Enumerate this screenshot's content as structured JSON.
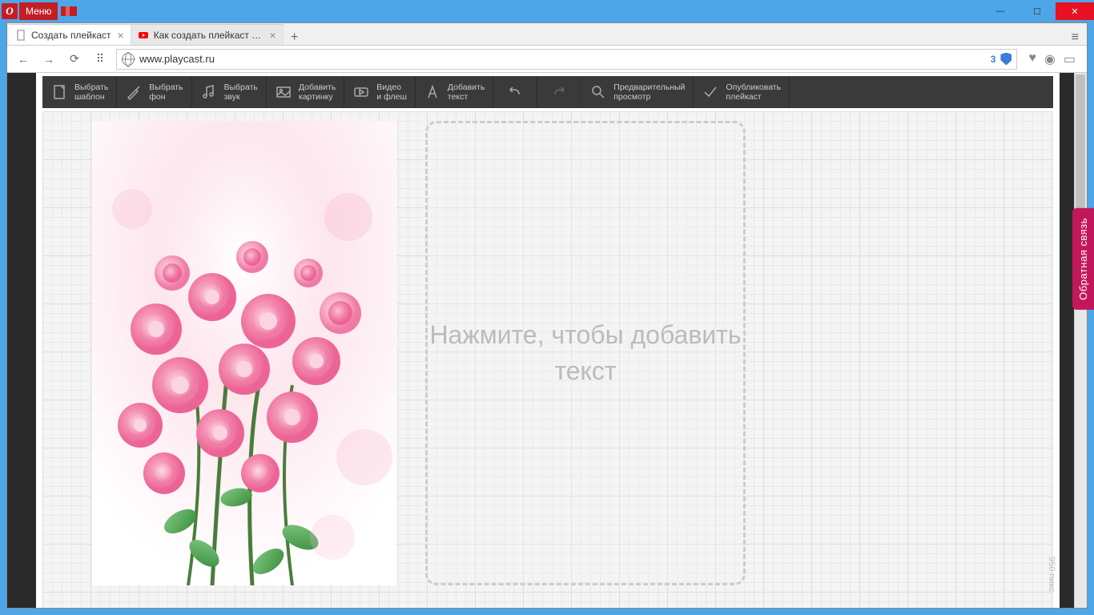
{
  "titlebar": {
    "menu_label": "Меню"
  },
  "window_controls": {
    "min": "—",
    "max": "☐",
    "close": "✕"
  },
  "tabs": [
    {
      "title": "Создать плейкаст",
      "active": true,
      "icon": "file"
    },
    {
      "title": "Как создать плейкаст - Yo",
      "active": false,
      "icon": "youtube"
    }
  ],
  "tab_close_glyph": "×",
  "new_tab_glyph": "+",
  "tab_menu_glyph": "≡",
  "nav": {
    "back": "←",
    "forward": "→",
    "reload": "⟳",
    "apps": "⠿"
  },
  "address": {
    "url": "www.playcast.ru",
    "badge": "3"
  },
  "toolbar": [
    {
      "line1": "Выбрать",
      "line2": "шаблон",
      "icon": "template"
    },
    {
      "line1": "Выбрать",
      "line2": "фон",
      "icon": "brush"
    },
    {
      "line1": "Выбрать",
      "line2": "звук",
      "icon": "music"
    },
    {
      "line1": "Добавить",
      "line2": "картинку",
      "icon": "image"
    },
    {
      "line1": "Видео",
      "line2": "и флеш",
      "icon": "video"
    },
    {
      "line1": "Добавить",
      "line2": "текст",
      "icon": "text"
    },
    {
      "line1": "",
      "line2": "",
      "icon": "undo"
    },
    {
      "line1": "",
      "line2": "",
      "icon": "redo"
    },
    {
      "line1": "Предварительный",
      "line2": "просмотр",
      "icon": "preview"
    },
    {
      "line1": "Опубликовать",
      "line2": "плейкаст",
      "icon": "publish"
    }
  ],
  "canvas": {
    "text_placeholder": "Нажмите, чтобы добавить текст",
    "size_label": "950 пикс"
  },
  "feedback": {
    "label": "Обратная связь"
  }
}
